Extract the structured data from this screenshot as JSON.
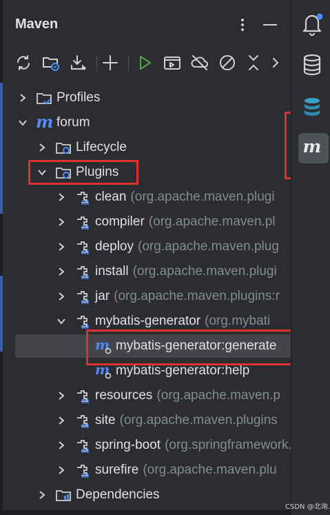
{
  "panel": {
    "title": "Maven"
  },
  "header": {
    "options_icon": "vertical-dots-icon",
    "minimize_icon": "minimize-icon"
  },
  "toolbar": {
    "buttons": [
      {
        "icon": "reload-icon"
      },
      {
        "icon": "folder-sync-icon"
      },
      {
        "icon": "download-icon"
      },
      {
        "icon": "plus-icon"
      },
      {
        "icon": "run-icon"
      },
      {
        "icon": "execute-goal-icon"
      },
      {
        "icon": "toggle-offline-icon"
      },
      {
        "icon": "skip-tests-icon"
      },
      {
        "icon": "collapse-all-icon"
      },
      {
        "icon": "chevron-right-icon"
      }
    ]
  },
  "tree": {
    "profiles": "Profiles",
    "project": "forum",
    "lifecycle": "Lifecycle",
    "plugins": "Plugins",
    "plugin_items": [
      {
        "name": "clean",
        "group": "(org.apache.maven.plugi"
      },
      {
        "name": "compiler",
        "group": "(org.apache.maven.pl"
      },
      {
        "name": "deploy",
        "group": "(org.apache.maven.plug"
      },
      {
        "name": "install",
        "group": "(org.apache.maven.plugi"
      },
      {
        "name": "jar",
        "group": "(org.apache.maven.plugins:r"
      },
      {
        "name": "mybatis-generator",
        "group": "(org.mybati"
      },
      {
        "name": "resources",
        "group": "(org.apache.maven.p"
      },
      {
        "name": "site",
        "group": "(org.apache.maven.plugins"
      },
      {
        "name": "spring-boot",
        "group": "(org.springframework.bo"
      },
      {
        "name": "surefire",
        "group": "(org.apache.maven.plu"
      }
    ],
    "goals": [
      {
        "name": "mybatis-generator:generate"
      },
      {
        "name": "mybatis-generator:help"
      }
    ],
    "dependencies": "Dependencies"
  },
  "right_toolbar": {
    "items": [
      {
        "icon": "notifications-icon"
      },
      {
        "icon": "database-icon"
      },
      {
        "icon": "database-teal-icon"
      },
      {
        "icon": "maven-icon"
      }
    ]
  },
  "watermark": "CSDN @北询.",
  "colors": {
    "background": "#2b2d30",
    "highlight": "#e03030",
    "maven_blue": "#548af7",
    "gear_blue": "#3574f0"
  }
}
